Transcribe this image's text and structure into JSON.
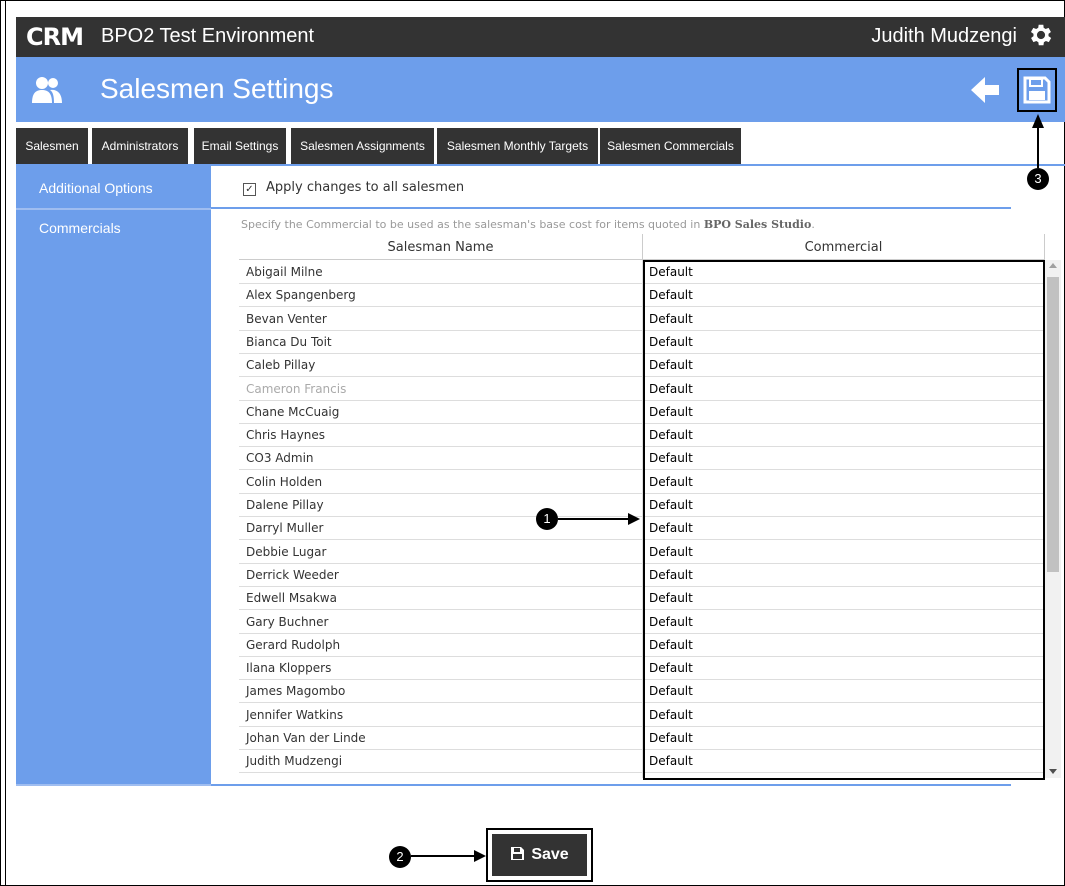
{
  "topbar": {
    "logo": "CRM",
    "environment": "BPO2 Test Environment",
    "user": "Judith Mudzengi",
    "settings_icon": "gear-icon"
  },
  "header": {
    "title": "Salesmen Settings",
    "page_icon": "users-icon",
    "back_icon": "arrow-left-icon",
    "save_icon": "floppy-disk-icon"
  },
  "tabs": [
    "Salesmen",
    "Administrators",
    "Email Settings",
    "Salesmen Assignments",
    "Salesmen Monthly Targets",
    "Salesmen Commercials"
  ],
  "sidebar": {
    "items": [
      "Additional Options",
      "Commercials"
    ]
  },
  "apply_all": {
    "label": "Apply changes to all salesmen",
    "checked": true
  },
  "description": {
    "text": "Specify the Commercial to be used as the salesman's base cost for items quoted in ",
    "emphasis": "BPO Sales Studio",
    "end": "."
  },
  "table": {
    "columns": [
      "Salesman Name",
      "Commercial"
    ],
    "rows": [
      {
        "name": "Abigail Milne",
        "commercial": "Default"
      },
      {
        "name": "Alex Spangenberg",
        "commercial": "Default"
      },
      {
        "name": "Bevan Venter",
        "commercial": "Default"
      },
      {
        "name": "Bianca Du Toit",
        "commercial": "Default"
      },
      {
        "name": "Caleb Pillay",
        "commercial": "Default"
      },
      {
        "name": "Cameron Francis",
        "commercial": "Default",
        "inactive": true
      },
      {
        "name": "Chane McCuaig",
        "commercial": "Default"
      },
      {
        "name": "Chris Haynes",
        "commercial": "Default"
      },
      {
        "name": "CO3 Admin",
        "commercial": "Default"
      },
      {
        "name": "Colin Holden",
        "commercial": "Default"
      },
      {
        "name": "Dalene Pillay",
        "commercial": "Default"
      },
      {
        "name": "Darryl Muller",
        "commercial": "Default"
      },
      {
        "name": "Debbie Lugar",
        "commercial": "Default"
      },
      {
        "name": "Derrick Weeder",
        "commercial": "Default"
      },
      {
        "name": "Edwell Msakwa",
        "commercial": "Default"
      },
      {
        "name": "Gary Buchner",
        "commercial": "Default"
      },
      {
        "name": "Gerard Rudolph",
        "commercial": "Default"
      },
      {
        "name": "Ilana Kloppers",
        "commercial": "Default"
      },
      {
        "name": "James Magombo",
        "commercial": "Default"
      },
      {
        "name": "Jennifer Watkins",
        "commercial": "Default"
      },
      {
        "name": "Johan Van der Linde",
        "commercial": "Default"
      },
      {
        "name": "Judith Mudzengi",
        "commercial": "Default"
      }
    ]
  },
  "save_button": {
    "label": "Save",
    "icon": "floppy-disk-icon"
  },
  "callouts": [
    "1",
    "2",
    "3"
  ],
  "colors": {
    "dark": "#333333",
    "accent": "#6d9eeb"
  }
}
